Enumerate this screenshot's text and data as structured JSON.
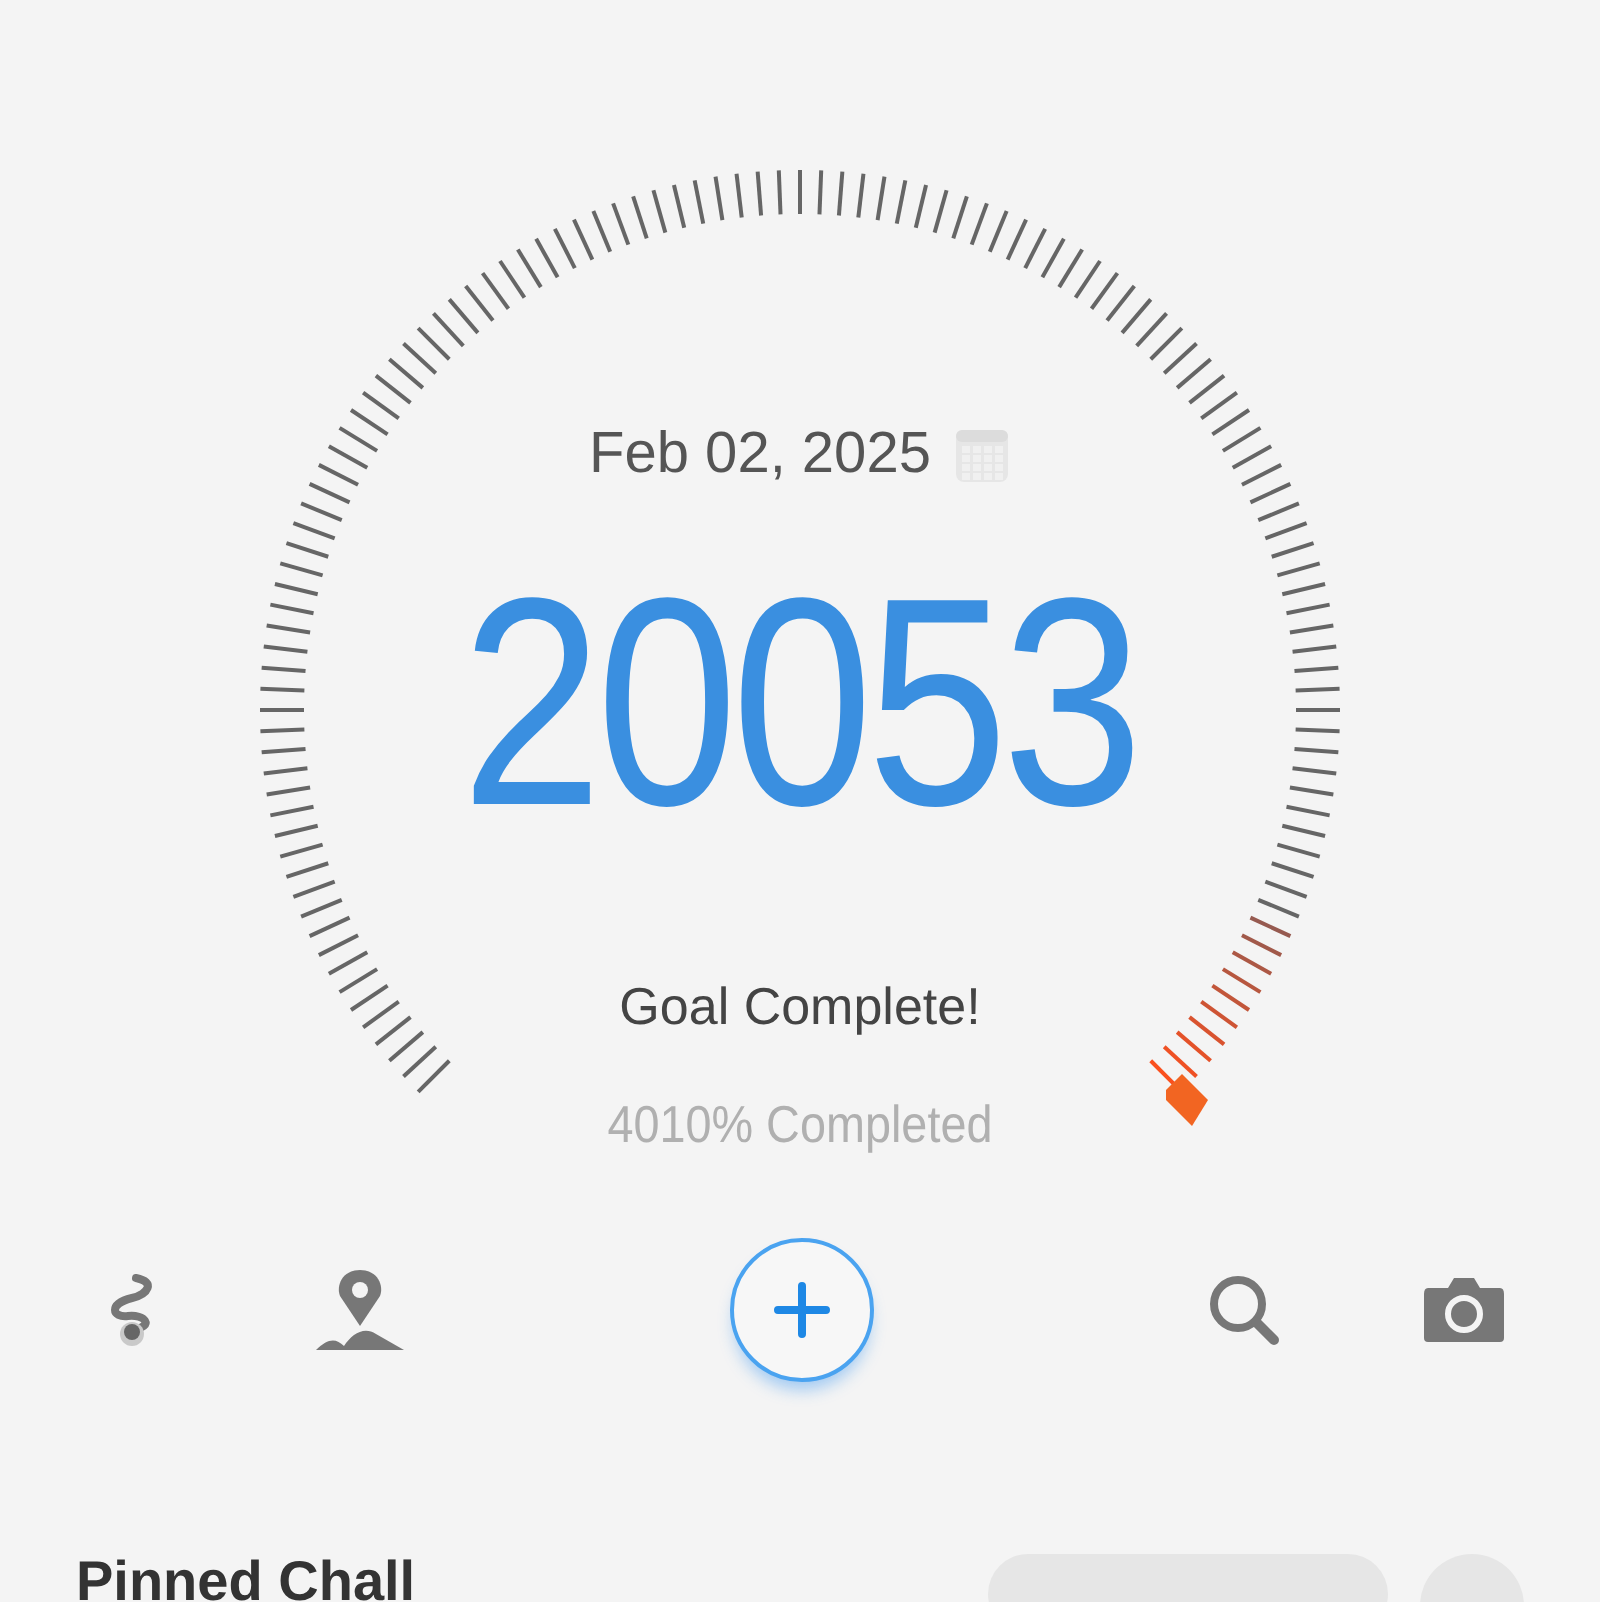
{
  "gauge": {
    "date": "Feb 02, 2025",
    "steps": "20053",
    "status": "Goal Complete!",
    "percent": "4010% Completed"
  },
  "toolbar": [
    {
      "kind": "route"
    },
    {
      "kind": "map"
    },
    {
      "kind": "add"
    },
    {
      "kind": "search"
    },
    {
      "kind": "camera"
    }
  ],
  "section": {
    "title": "Pinned Chall"
  }
}
